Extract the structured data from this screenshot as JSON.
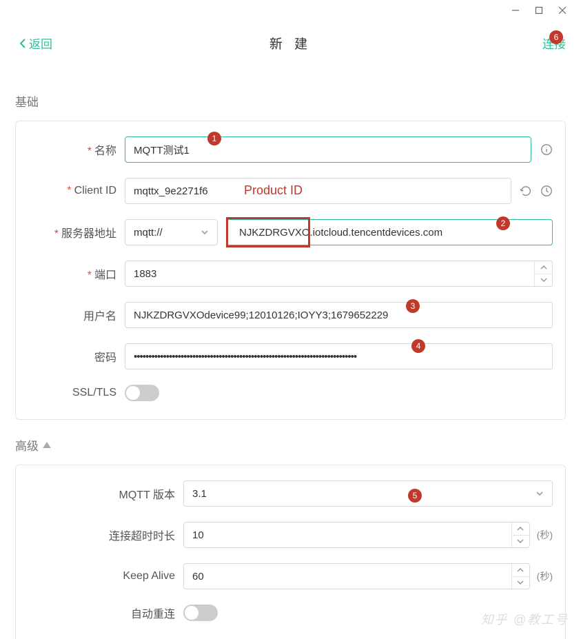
{
  "window": {
    "min": "—",
    "max": "☐",
    "close": "✕"
  },
  "header": {
    "back": "返回",
    "title": "新 建",
    "action": "连接"
  },
  "sections": {
    "basic": "基础",
    "advanced": "高级"
  },
  "labels": {
    "name": "名称",
    "clientId": "Client ID",
    "server": "服务器地址",
    "port": "端口",
    "username": "用户名",
    "password": "密码",
    "ssl": "SSL/TLS",
    "mqttVersion": "MQTT 版本",
    "connTimeout": "连接超时时长",
    "keepAlive": "Keep Alive",
    "autoReconnect": "自动重连"
  },
  "values": {
    "name": "MQTT测试1",
    "clientId": "mqttx_9e2271f6",
    "scheme": "mqtt://",
    "server": "NJKZDRGVXO.iotcloud.tencentdevices.com",
    "port": "1883",
    "username": "NJKZDRGVXOdevice99;12010126;IOYY3;1679652229",
    "password": "••••••••••••••••••••••••••••••••••••••••••••••••••••••••••••••••••••••••••••",
    "mqttVersion": "3.1",
    "connTimeout": "10",
    "keepAlive": "60"
  },
  "units": {
    "seconds": "(秒)"
  },
  "annotations": {
    "productId": "Product ID",
    "b1": "1",
    "b2": "2",
    "b3": "3",
    "b4": "4",
    "b5": "5",
    "b6": "6"
  },
  "watermark": "知乎 @教工号"
}
